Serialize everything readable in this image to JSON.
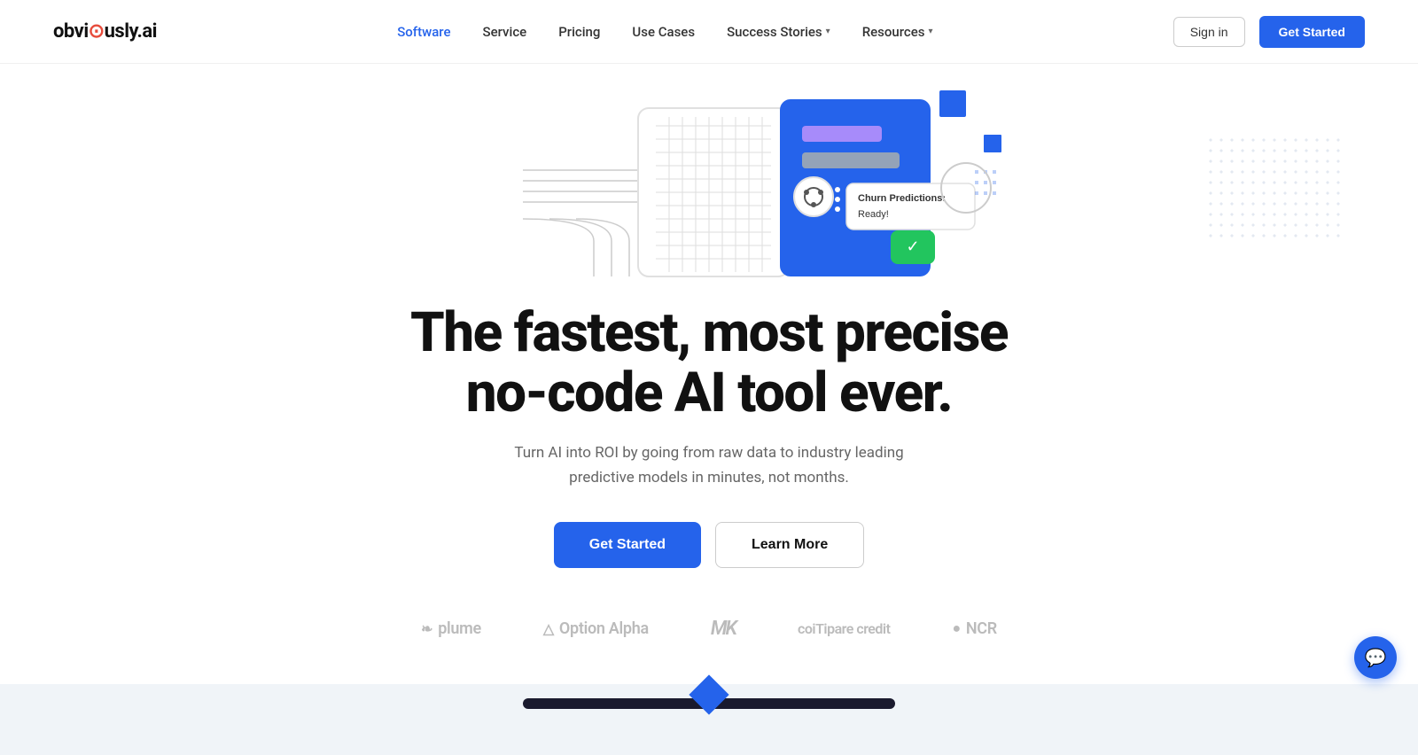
{
  "logo": {
    "text": "obviously.ai",
    "dot_char": "·"
  },
  "navbar": {
    "links": [
      {
        "label": "Software",
        "active": true
      },
      {
        "label": "Service",
        "active": false
      },
      {
        "label": "Pricing",
        "active": false
      },
      {
        "label": "Use Cases",
        "active": false
      },
      {
        "label": "Success Stories",
        "active": false,
        "has_dropdown": true
      },
      {
        "label": "Resources",
        "active": false,
        "has_dropdown": true
      }
    ],
    "signin_label": "Sign in",
    "get_started_label": "Get Started"
  },
  "hero": {
    "headline_line1": "The fastest, most precise",
    "headline_line2": "no-code AI tool ever.",
    "subtext": "Turn AI into ROI by going from raw data to industry leading predictive models in minutes, not months.",
    "cta_primary": "Get Started",
    "cta_secondary": "Learn More"
  },
  "illustration": {
    "notification_label": "Churn Predictions:",
    "notification_status": "Ready!"
  },
  "logos": [
    {
      "name": "plume",
      "icon": "❧",
      "text": "plume"
    },
    {
      "name": "option-alpha",
      "icon": "△",
      "text": "Option Alpha"
    },
    {
      "name": "mk",
      "icon": "",
      "text": "MK"
    },
    {
      "name": "compare-credit",
      "icon": "",
      "text": "coiTipare credit"
    },
    {
      "name": "ncr",
      "icon": "●",
      "text": "NCR"
    }
  ],
  "chat": {
    "icon": "💬"
  }
}
